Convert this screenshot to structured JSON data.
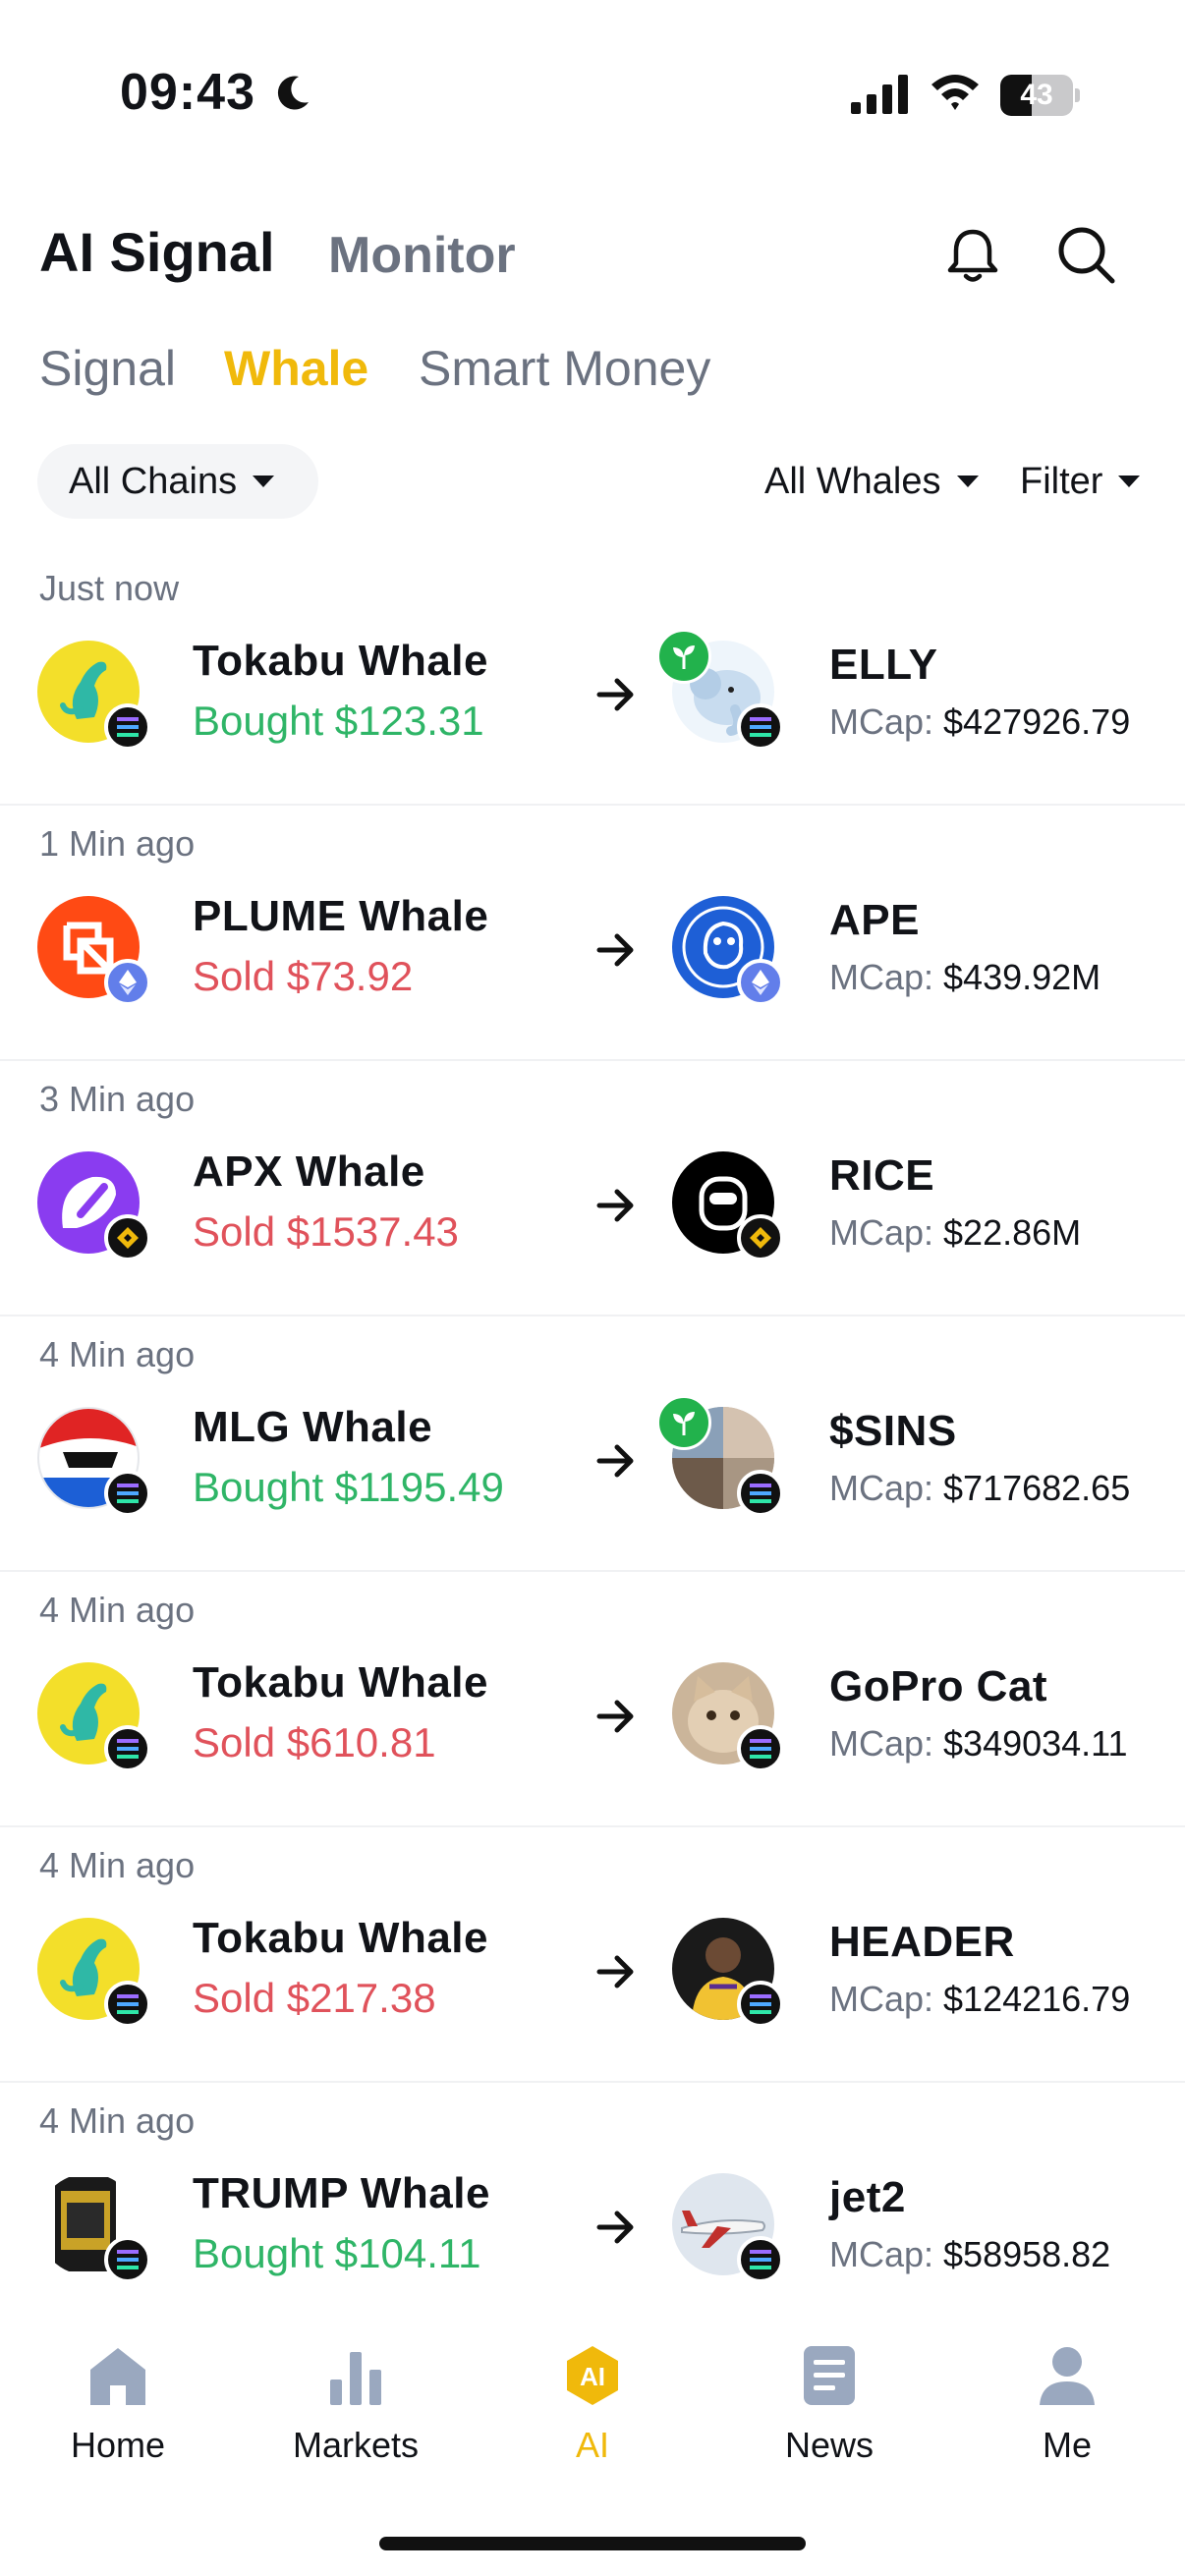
{
  "status_bar": {
    "time": "09:43",
    "battery_level": "43",
    "battery_fraction": 0.43
  },
  "header": {
    "title": "AI Signal",
    "subtitle": "Monitor"
  },
  "tabs": [
    {
      "label": "Signal",
      "active": false
    },
    {
      "label": "Whale",
      "active": true
    },
    {
      "label": "Smart Money",
      "active": false
    }
  ],
  "filters": {
    "chain": "All Chains",
    "whales": "All Whales",
    "filter": "Filter"
  },
  "colors": {
    "accent": "#f0b90b",
    "buy": "#2fb567",
    "sell": "#e0525b",
    "muted": "#6b7280"
  },
  "rows": [
    {
      "time": "Just now",
      "whale": "Tokabu Whale",
      "action": "Bought",
      "amount": "$123.31",
      "token": "ELLY",
      "mcap_label": "MCap:",
      "mcap": "$427926.79",
      "chain": "solana",
      "new": true
    },
    {
      "time": "1 Min ago",
      "whale": "PLUME Whale",
      "action": "Sold",
      "amount": "$73.92",
      "token": "APE",
      "mcap_label": "MCap:",
      "mcap": "$439.92M",
      "chain": "ethereum",
      "new": false
    },
    {
      "time": "3 Min ago",
      "whale": "APX Whale",
      "action": "Sold",
      "amount": "$1537.43",
      "token": "RICE",
      "mcap_label": "MCap:",
      "mcap": "$22.86M",
      "chain": "bnb",
      "new": false
    },
    {
      "time": "4 Min ago",
      "whale": "MLG Whale",
      "action": "Bought",
      "amount": "$1195.49",
      "token": "$SINS",
      "mcap_label": "MCap:",
      "mcap": "$717682.65",
      "chain": "solana",
      "new": true
    },
    {
      "time": "4 Min ago",
      "whale": "Tokabu Whale",
      "action": "Sold",
      "amount": "$610.81",
      "token": "GoPro Cat",
      "mcap_label": "MCap:",
      "mcap": "$349034.11",
      "chain": "solana",
      "new": false
    },
    {
      "time": "4 Min ago",
      "whale": "Tokabu Whale",
      "action": "Sold",
      "amount": "$217.38",
      "token": "HEADER",
      "mcap_label": "MCap:",
      "mcap": "$124216.79",
      "chain": "solana",
      "new": false
    },
    {
      "time": "4 Min ago",
      "whale": "TRUMP Whale",
      "action": "Bought",
      "amount": "$104.11",
      "token": "jet2",
      "mcap_label": "MCap:",
      "mcap": "$58958.82",
      "chain": "solana",
      "new": false
    }
  ],
  "bottom_nav": [
    {
      "label": "Home",
      "icon": "home-icon",
      "active": false
    },
    {
      "label": "Markets",
      "icon": "bar-chart-icon",
      "active": false
    },
    {
      "label": "AI",
      "icon": "ai-icon",
      "active": true
    },
    {
      "label": "News",
      "icon": "news-icon",
      "active": false
    },
    {
      "label": "Me",
      "icon": "person-icon",
      "active": false
    }
  ]
}
